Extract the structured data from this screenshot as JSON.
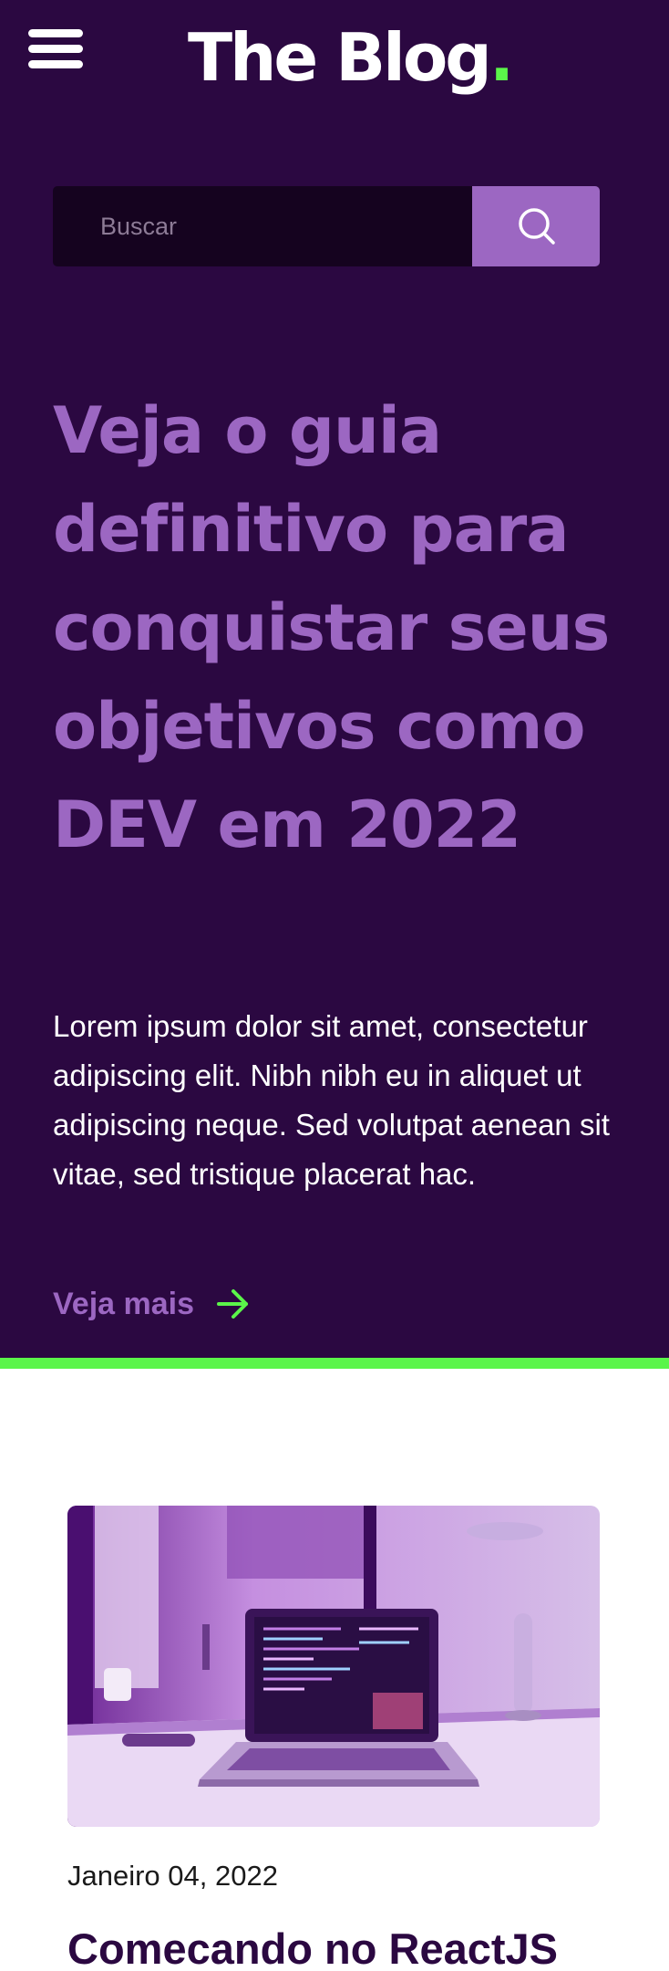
{
  "header": {
    "logo_text": "The Blog",
    "logo_dot": ".",
    "menu_icon": "hamburger-menu-icon"
  },
  "search": {
    "placeholder": "Buscar",
    "value": "",
    "icon": "search-icon"
  },
  "hero": {
    "title": "Veja o guia definitivo para conquistar seus objetivos como DEV em 2022",
    "description": "Lorem ipsum dolor sit amet, consectetur adipiscing elit. Nibh nibh eu in aliquet ut adipiscing neque. Sed volutpat aenean sit vitae, sed tristique placerat hac.",
    "link_label": "Veja mais",
    "link_icon": "arrow-right-icon"
  },
  "post": {
    "date": "Janeiro 04, 2022",
    "title": "Comecando no ReactJS",
    "image_icon": "laptop-desk-image"
  },
  "colors": {
    "background": "#2b0841",
    "accent_purple": "#9c67c2",
    "accent_green": "#5bf54a",
    "search_field": "#15031f",
    "white": "#ffffff"
  }
}
